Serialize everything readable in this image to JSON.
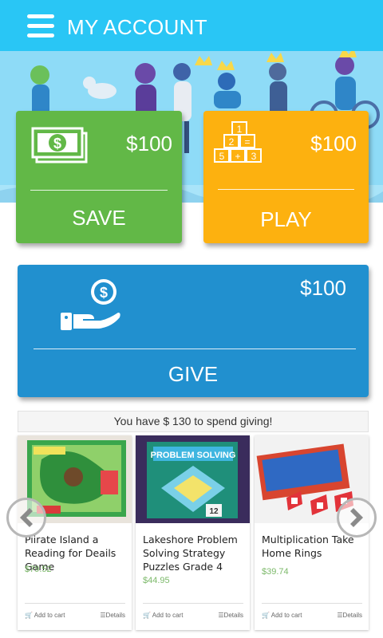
{
  "header": {
    "title": "MY ACCOUNT",
    "menu_icon": "hamburger-menu-icon"
  },
  "colors": {
    "header": "#29c6f5",
    "save": "#62b847",
    "play": "#fdb10f",
    "give": "#2190cf",
    "price": "#7cb96a"
  },
  "cards": {
    "save": {
      "amount": "$100",
      "label": "SAVE",
      "icon": "money-bill-icon"
    },
    "play": {
      "amount": "$100",
      "label": "PLAY",
      "icon": "number-blocks-icon"
    },
    "give": {
      "amount": "$100",
      "label": "GIVE",
      "icon": "hand-coin-icon"
    }
  },
  "notice": "You have $ 130 to spend giving!",
  "products": [
    {
      "name": "Piirate Island a Reading for Deails Game",
      "price": "$79.52",
      "add_to_cart": "Add to cart",
      "details": "Details"
    },
    {
      "name": "Lakeshore Problem Solving Strategy Puzzles Grade 4",
      "price": "$44.95",
      "add_to_cart": "Add to cart",
      "details": "Details",
      "thumb_text": "PROBLEM SOLVING",
      "thumb_grade": "12"
    },
    {
      "name": "Multiplication Take Home Rings",
      "price": "$39.74",
      "add_to_cart": "Add to cart",
      "details": "Details"
    }
  ]
}
